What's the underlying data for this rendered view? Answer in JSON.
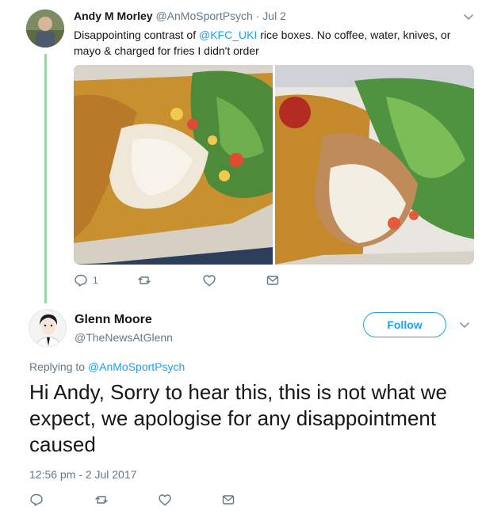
{
  "parent": {
    "display_name": "Andy M Morley",
    "handle": "@AnMoSportPsych",
    "dot": "·",
    "date": "Jul 2",
    "text_before": "Disappointing contrast of ",
    "mention": "@KFC_UKI",
    "text_after": " rice boxes. No coffee, water, knives, or mayo & charged for fries I didn't order",
    "reply_count": "1",
    "icons": [
      "reply-icon",
      "retweet-icon",
      "like-icon",
      "dm-icon",
      "chevron-down-icon"
    ]
  },
  "reply": {
    "display_name": "Glenn Moore",
    "handle": "@TheNewsAtGlenn",
    "follow_label": "Follow",
    "replying_to_label": "Replying to ",
    "replying_to_handle": "@AnMoSportPsych",
    "text": "Hi Andy, Sorry to hear this, this is not what we expect, we apologise for any disappointment caused",
    "timestamp": "12:56 pm - 2 Jul 2017"
  },
  "colors": {
    "link": "#1da1f2",
    "muted": "#657786",
    "thread_line": "#9ad6a5"
  }
}
